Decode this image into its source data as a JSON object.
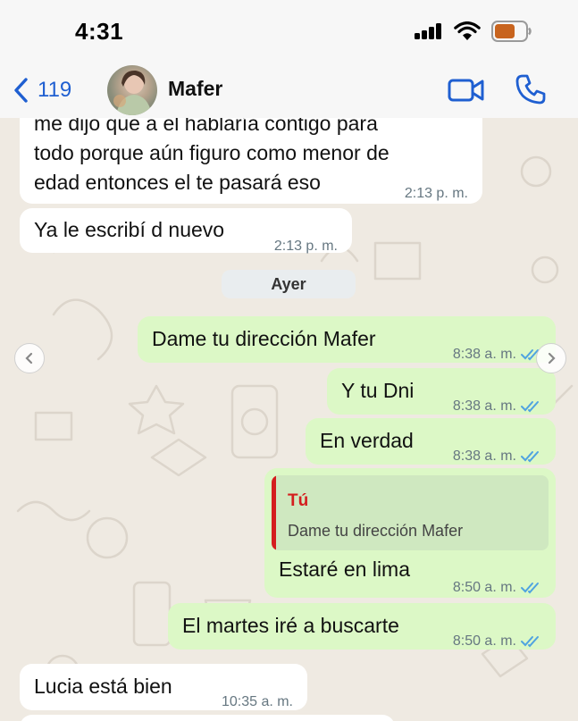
{
  "status_bar": {
    "time": "4:31"
  },
  "header": {
    "back_count": "119",
    "contact_name": "Mafer"
  },
  "colors": {
    "ios_blue": "#1f5fd1",
    "outgoing_bubble": "#dcf8c6",
    "incoming_bubble": "#ffffff",
    "chat_background": "#efeae2",
    "read_ticks": "#4fa3e0",
    "quote_accent": "#d41e1e"
  },
  "icons": {
    "back": "chevron-left-icon",
    "video": "video-camera-icon",
    "phone": "phone-icon",
    "read_receipt": "double-check-icon"
  },
  "day_divider": "Ayer",
  "messages": [
    {
      "direction": "in",
      "lines": [
        "me dijo que a el hablaría contigo para",
        "todo porque aún figuro como menor de",
        "edad entonces el te pasará eso"
      ],
      "time": "2:13 p. m."
    },
    {
      "direction": "in",
      "text": "Ya le escribí d nuevo",
      "time": "2:13 p. m."
    },
    {
      "direction": "out",
      "text": "Dame tu dirección Mafer",
      "time": "8:38 a. m."
    },
    {
      "direction": "out",
      "text": "Y tu Dni",
      "time": "8:38 a. m."
    },
    {
      "direction": "out",
      "text": "En verdad",
      "time": "8:38 a. m."
    },
    {
      "direction": "out",
      "quote_author": "Tú",
      "quote_text": "Dame tu dirección Mafer",
      "text": "Estaré en lima",
      "time": "8:50 a. m."
    },
    {
      "direction": "out",
      "text": "El martes iré a buscarte",
      "time": "8:50 a. m."
    },
    {
      "direction": "in",
      "text": "Lucia está bien",
      "time": "10:35 a. m."
    }
  ]
}
